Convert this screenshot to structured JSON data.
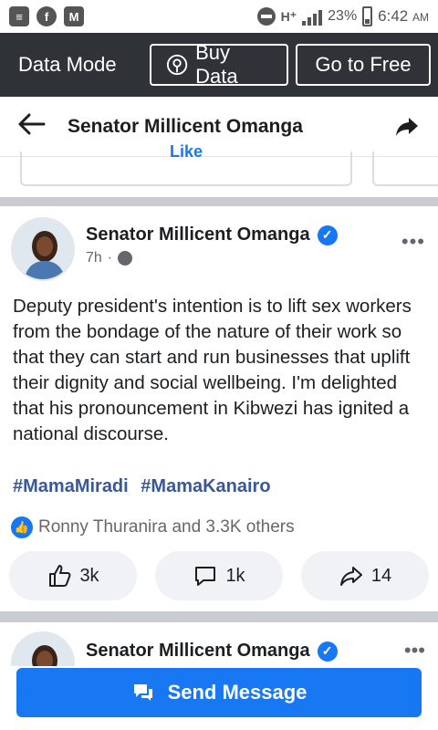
{
  "status_bar": {
    "battery": "23%",
    "time": "6:42",
    "ampm": "AM",
    "network": "H⁺",
    "icons": [
      "sms-icon",
      "facebook-icon",
      "gmail-icon"
    ]
  },
  "data_bar": {
    "mode_label": "Data Mode",
    "buy_label": "Buy Data",
    "free_label": "Go to Free"
  },
  "header": {
    "title": "Senator Millicent Omanga"
  },
  "prev_card": {
    "like_label": "Like"
  },
  "post": {
    "author": "Senator Millicent Omanga",
    "time": "7h",
    "text": "Deputy president's intention is to lift sex workers from the bondage of the nature of their work so that they can start and run businesses that uplift their dignity and social wellbeing. I'm delighted that his pronouncement in Kibwezi has ignited a national discourse.",
    "hashtags": [
      "#MamaMiradi",
      "#MamaKanairo"
    ],
    "reactions_text": "Ronny Thuranira and 3.3K others",
    "like_count": "3k",
    "comment_count": "1k",
    "share_count": "14"
  },
  "next_post": {
    "author": "Senator Millicent Omanga"
  },
  "send_message": {
    "label": "Send Message"
  },
  "colors": {
    "accent": "#1877f2",
    "hashtag": "#385898",
    "data_bar": "#2f3236"
  }
}
